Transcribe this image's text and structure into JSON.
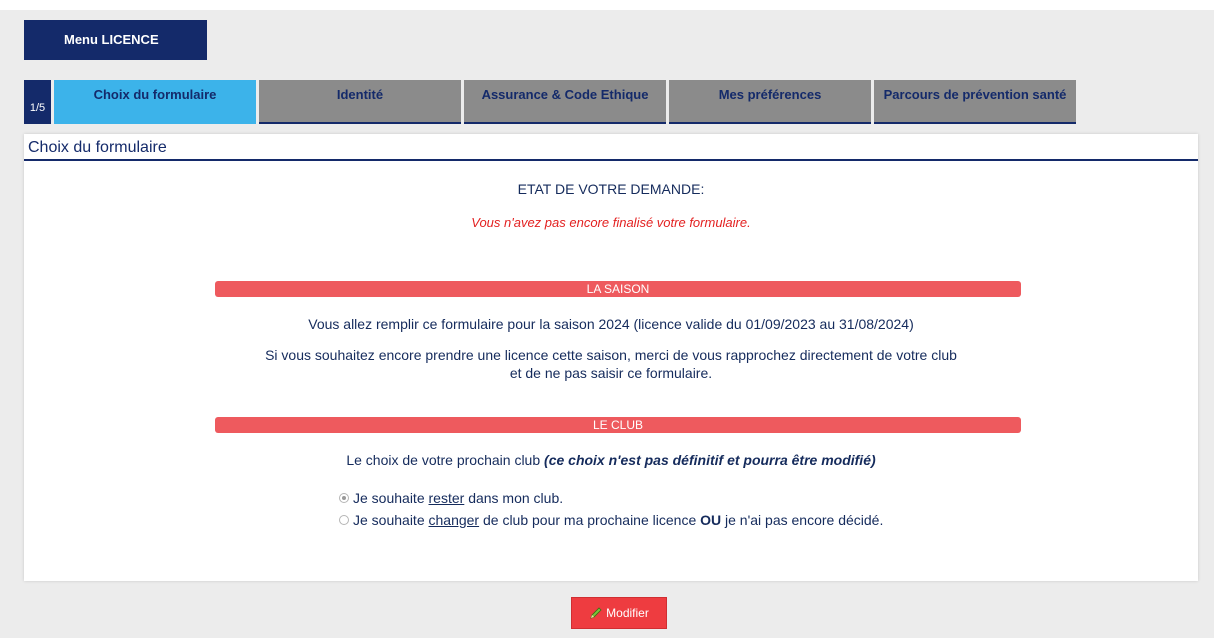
{
  "menu": {
    "label": "Menu LICENCE"
  },
  "tabs": {
    "step": "1/5",
    "items": [
      {
        "label": "Choix du formulaire"
      },
      {
        "label": "Identité"
      },
      {
        "label": "Assurance & Code Ethique"
      },
      {
        "label": "Mes préférences"
      },
      {
        "label": "Parcours de prévention santé"
      }
    ]
  },
  "panel": {
    "title": "Choix du formulaire",
    "state_heading": "ETAT DE VOTRE DEMANDE:",
    "state_message": "Vous n'avez pas encore finalisé votre formulaire.",
    "season": {
      "bar_label": "LA SAISON",
      "text1": "Vous allez remplir ce formulaire pour la saison 2024 (licence valide du 01/09/2023 au 31/08/2024)",
      "text2_line1": "Si vous souhaitez encore prendre une licence cette saison, merci de vous rapprochez directement de votre club",
      "text2_line2": "et de ne pas saisir ce formulaire."
    },
    "club": {
      "bar_label": "LE CLUB",
      "intro": "Le choix de votre prochain club",
      "intro_note": "(ce choix n'est pas définitif et pourra être modifié)",
      "option1": {
        "pre": "Je souhaite",
        "emph": "rester",
        "post": "dans mon club.",
        "checked": true
      },
      "option2": {
        "pre": "Je souhaite",
        "emph": "changer",
        "mid": "de club pour ma prochaine licence",
        "bold": "OU",
        "post": "je n'ai pas encore décidé.",
        "checked": false
      }
    }
  },
  "actions": {
    "modify_label": "Modifier",
    "modify_icon": "pencil-icon"
  },
  "colors": {
    "navy": "#142a6a",
    "active_tab": "#3cb3ea",
    "inactive_tab": "#8b8b8b",
    "bar": "#ee5a5e",
    "warning": "#e32121",
    "button": "#ee3c40"
  }
}
